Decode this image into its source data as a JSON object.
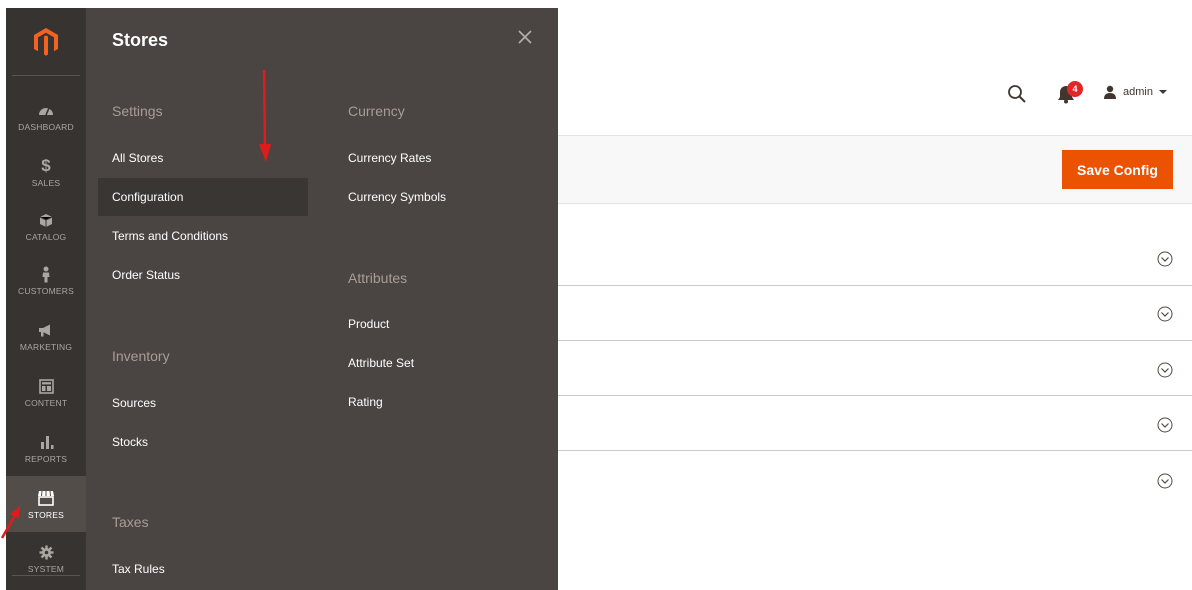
{
  "nav": {
    "items": [
      {
        "label": "DASHBOARD",
        "icon": "dashboard-icon"
      },
      {
        "label": "SALES",
        "icon": "dollar-icon"
      },
      {
        "label": "CATALOG",
        "icon": "cube-icon"
      },
      {
        "label": "CUSTOMERS",
        "icon": "person-icon"
      },
      {
        "label": "MARKETING",
        "icon": "megaphone-icon"
      },
      {
        "label": "CONTENT",
        "icon": "layout-icon"
      },
      {
        "label": "REPORTS",
        "icon": "bar-chart-icon"
      },
      {
        "label": "STORES",
        "icon": "storefront-icon"
      },
      {
        "label": "SYSTEM",
        "icon": "gear-icon"
      }
    ],
    "active": "STORES"
  },
  "flyout": {
    "title": "Stores",
    "settings": {
      "title": "Settings",
      "links": [
        "All Stores",
        "Configuration",
        "Terms and Conditions",
        "Order Status"
      ],
      "active": "Configuration"
    },
    "inventory": {
      "title": "Inventory",
      "links": [
        "Sources",
        "Stocks"
      ]
    },
    "taxes": {
      "title": "Taxes",
      "links": [
        "Tax Rules"
      ]
    },
    "currency": {
      "title": "Currency",
      "links": [
        "Currency Rates",
        "Currency Symbols"
      ]
    },
    "attributes": {
      "title": "Attributes",
      "links": [
        "Product",
        "Attribute Set",
        "Rating"
      ]
    }
  },
  "header": {
    "user_name": "admin",
    "notification_count": "4"
  },
  "toolbar": {
    "save_label": "Save Config"
  },
  "colors": {
    "nav_bg": "#373330",
    "flyout_bg": "#4a4542",
    "accent": "#eb5202",
    "badge": "#e22626",
    "annotation_arrow": "#e01b1b"
  }
}
